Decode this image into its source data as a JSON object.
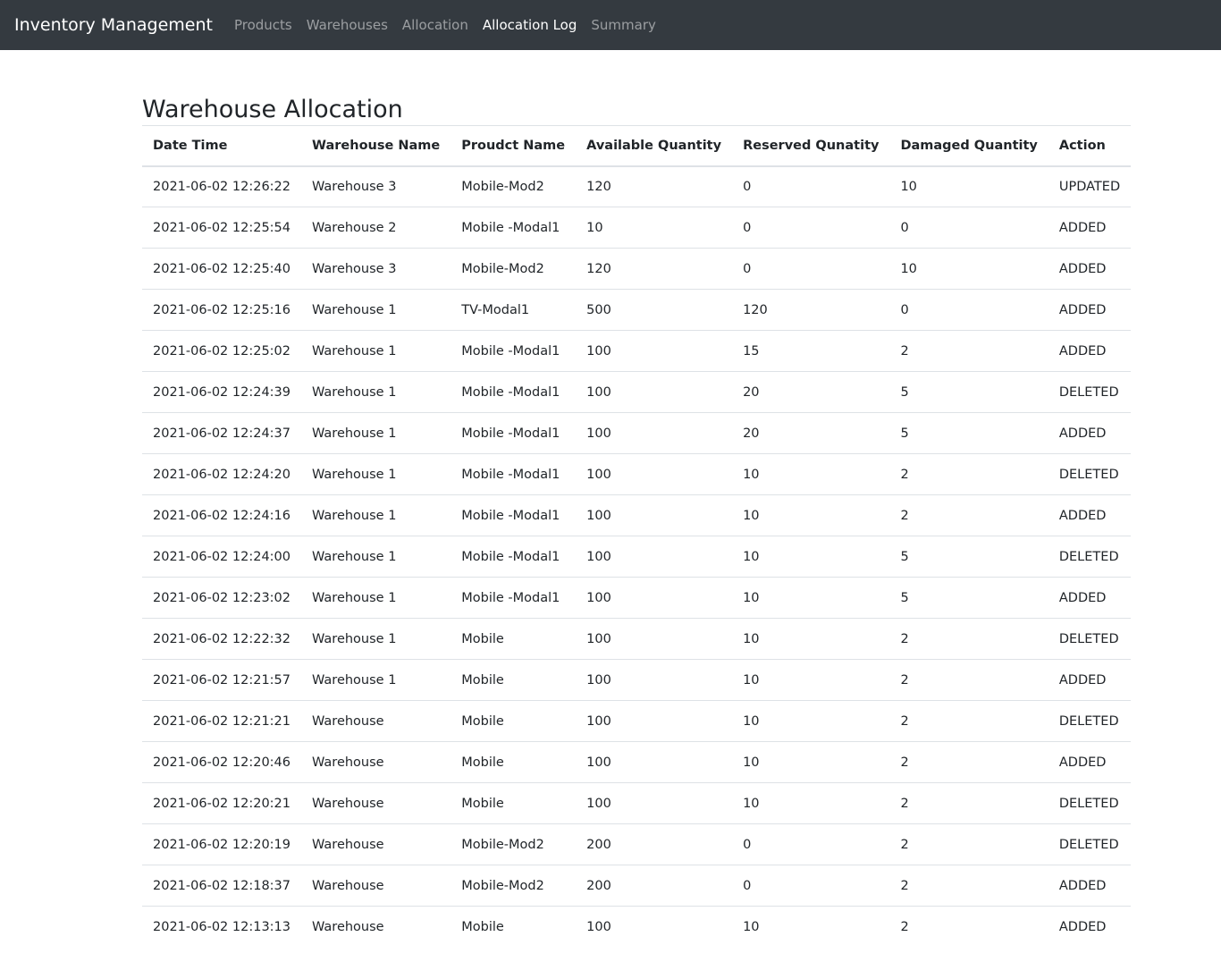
{
  "navbar": {
    "brand": "Inventory Management",
    "links": [
      {
        "label": "Products",
        "active": false
      },
      {
        "label": "Warehouses",
        "active": false
      },
      {
        "label": "Allocation",
        "active": false
      },
      {
        "label": "Allocation Log",
        "active": true
      },
      {
        "label": "Summary",
        "active": false
      }
    ]
  },
  "page": {
    "title": "Warehouse Allocation"
  },
  "table": {
    "headers": [
      "Date Time",
      "Warehouse Name",
      "Proudct Name",
      "Available Quantity",
      "Reserved Qunatity",
      "Damaged Quantity",
      "Action"
    ],
    "rows": [
      [
        "2021-06-02 12:26:22",
        "Warehouse 3",
        "Mobile-Mod2",
        "120",
        "0",
        "10",
        "UPDATED"
      ],
      [
        "2021-06-02 12:25:54",
        "Warehouse 2",
        "Mobile -Modal1",
        "10",
        "0",
        "0",
        "ADDED"
      ],
      [
        "2021-06-02 12:25:40",
        "Warehouse 3",
        "Mobile-Mod2",
        "120",
        "0",
        "10",
        "ADDED"
      ],
      [
        "2021-06-02 12:25:16",
        "Warehouse 1",
        "TV-Modal1",
        "500",
        "120",
        "0",
        "ADDED"
      ],
      [
        "2021-06-02 12:25:02",
        "Warehouse 1",
        "Mobile -Modal1",
        "100",
        "15",
        "2",
        "ADDED"
      ],
      [
        "2021-06-02 12:24:39",
        "Warehouse 1",
        "Mobile -Modal1",
        "100",
        "20",
        "5",
        "DELETED"
      ],
      [
        "2021-06-02 12:24:37",
        "Warehouse 1",
        "Mobile -Modal1",
        "100",
        "20",
        "5",
        "ADDED"
      ],
      [
        "2021-06-02 12:24:20",
        "Warehouse 1",
        "Mobile -Modal1",
        "100",
        "10",
        "2",
        "DELETED"
      ],
      [
        "2021-06-02 12:24:16",
        "Warehouse 1",
        "Mobile -Modal1",
        "100",
        "10",
        "2",
        "ADDED"
      ],
      [
        "2021-06-02 12:24:00",
        "Warehouse 1",
        "Mobile -Modal1",
        "100",
        "10",
        "5",
        "DELETED"
      ],
      [
        "2021-06-02 12:23:02",
        "Warehouse 1",
        "Mobile -Modal1",
        "100",
        "10",
        "5",
        "ADDED"
      ],
      [
        "2021-06-02 12:22:32",
        "Warehouse 1",
        "Mobile",
        "100",
        "10",
        "2",
        "DELETED"
      ],
      [
        "2021-06-02 12:21:57",
        "Warehouse 1",
        "Mobile",
        "100",
        "10",
        "2",
        "ADDED"
      ],
      [
        "2021-06-02 12:21:21",
        "Warehouse",
        "Mobile",
        "100",
        "10",
        "2",
        "DELETED"
      ],
      [
        "2021-06-02 12:20:46",
        "Warehouse",
        "Mobile",
        "100",
        "10",
        "2",
        "ADDED"
      ],
      [
        "2021-06-02 12:20:21",
        "Warehouse",
        "Mobile",
        "100",
        "10",
        "2",
        "DELETED"
      ],
      [
        "2021-06-02 12:20:19",
        "Warehouse",
        "Mobile-Mod2",
        "200",
        "0",
        "2",
        "DELETED"
      ],
      [
        "2021-06-02 12:18:37",
        "Warehouse",
        "Mobile-Mod2",
        "200",
        "0",
        "2",
        "ADDED"
      ],
      [
        "2021-06-02 12:13:13",
        "Warehouse",
        "Mobile",
        "100",
        "10",
        "2",
        "ADDED"
      ]
    ]
  },
  "colors": {
    "navbar_bg": "#343a40",
    "nav_active": "#ffffff",
    "nav_inactive": "rgba(255,255,255,0.5)",
    "border": "#dee2e6"
  }
}
